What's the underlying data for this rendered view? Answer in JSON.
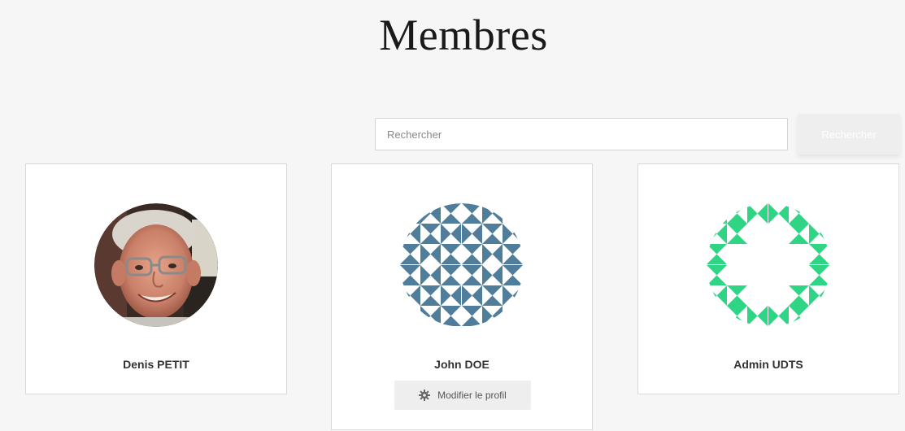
{
  "page": {
    "title": "Membres"
  },
  "search": {
    "placeholder": "Rechercher",
    "value": "",
    "button_label": "Rechercher"
  },
  "members": [
    {
      "name": "Denis PETIT",
      "avatar": "photo"
    },
    {
      "name": "John DOE",
      "avatar": "identicon",
      "edit_label": "Modifier le profil"
    },
    {
      "name": "Admin UDTS",
      "avatar": "identicon"
    }
  ],
  "colors": {
    "identicon_blue": "#4f7d9a",
    "identicon_green": "#2fd484",
    "background": "#f6f6f6"
  },
  "icons": {
    "edit": "gear-icon"
  }
}
